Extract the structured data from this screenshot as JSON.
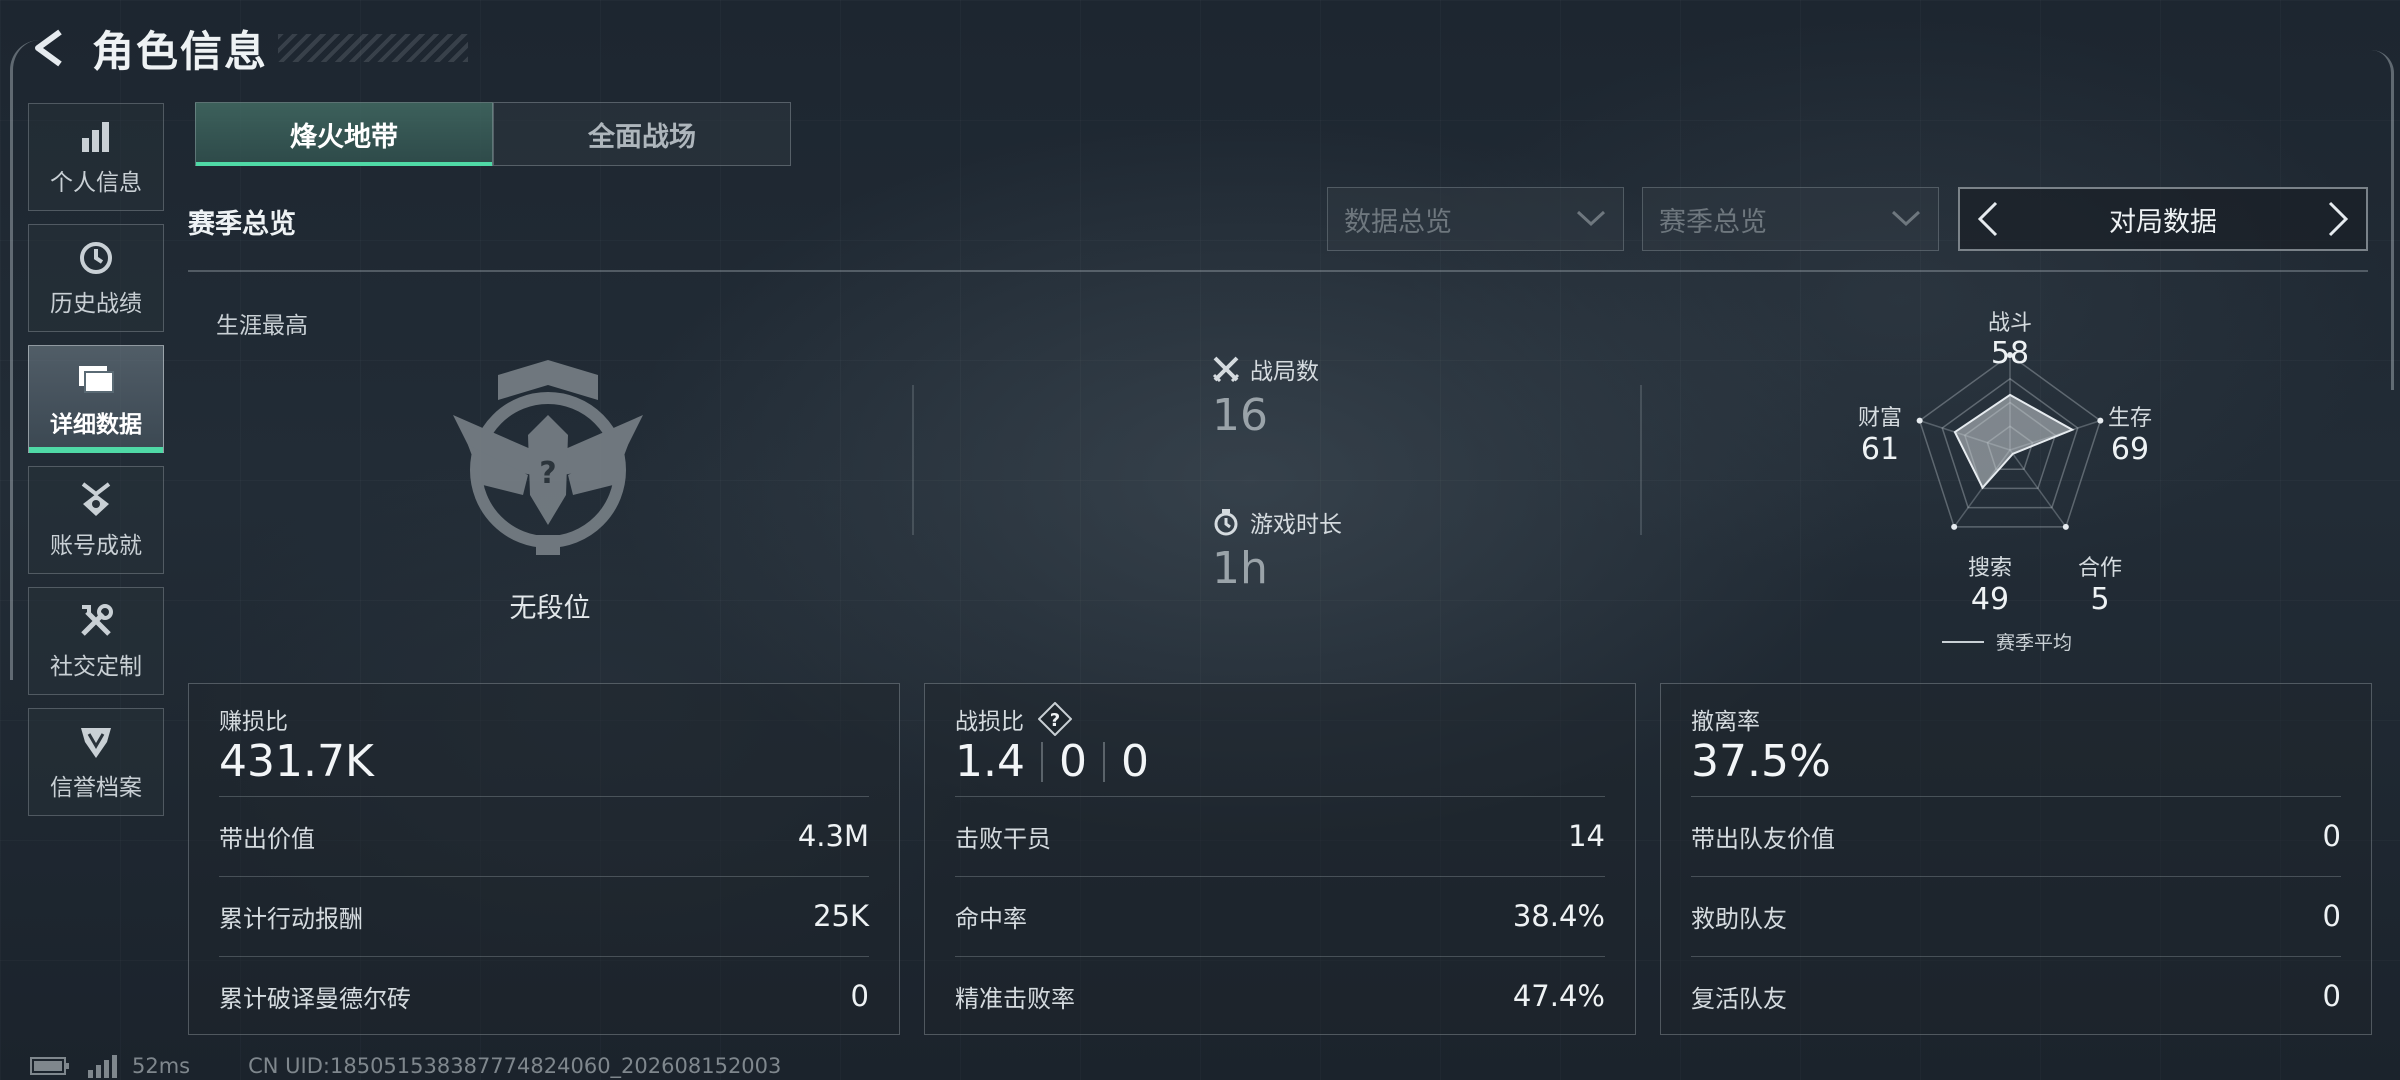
{
  "header": {
    "title": "角色信息"
  },
  "sidebar": {
    "items": [
      {
        "label": "个人信息",
        "icon": "bar-chart-icon"
      },
      {
        "label": "历史战绩",
        "icon": "history-clock-icon"
      },
      {
        "label": "详细数据",
        "icon": "folder-icon",
        "active": true
      },
      {
        "label": "账号成就",
        "icon": "medal-icon"
      },
      {
        "label": "社交定制",
        "icon": "tools-icon"
      },
      {
        "label": "信誉档案",
        "icon": "shield-badge-icon"
      }
    ]
  },
  "mode_tabs": [
    {
      "label": "烽火地带",
      "active": true
    },
    {
      "label": "全面战场",
      "active": false
    }
  ],
  "section": {
    "title": "赛季总览",
    "dropdown_data": "数据总览",
    "dropdown_season": "赛季总览",
    "stepper_label": "对局数据"
  },
  "overview": {
    "career_label": "生涯最高",
    "rank_text": "无段位",
    "matches_label": "战局数",
    "matches_value": "16",
    "playtime_label": "游戏时长",
    "playtime_value": "1h"
  },
  "radar": {
    "axes": [
      {
        "label": "战斗",
        "value": 58
      },
      {
        "label": "生存",
        "value": 69
      },
      {
        "label": "合作",
        "value": 5
      },
      {
        "label": "搜索",
        "value": 49
      },
      {
        "label": "财富",
        "value": 61
      }
    ],
    "legend": "赛季平均"
  },
  "cards": [
    {
      "label": "赚损比",
      "value": "431.7K",
      "rows": [
        {
          "label": "带出价值",
          "value": "4.3M"
        },
        {
          "label": "累计行动报酬",
          "value": "25K"
        },
        {
          "label": "累计破译曼德尔砖",
          "value": "0"
        }
      ]
    },
    {
      "label": "战损比",
      "values": [
        "1.4",
        "0",
        "0"
      ],
      "help": "?",
      "rows": [
        {
          "label": "击败干员",
          "value": "14"
        },
        {
          "label": "命中率",
          "value": "38.4%"
        },
        {
          "label": "精准击败率",
          "value": "47.4%"
        }
      ]
    },
    {
      "label": "撤离率",
      "value": "37.5%",
      "rows": [
        {
          "label": "带出队友价值",
          "value": "0"
        },
        {
          "label": "救助队友",
          "value": "0"
        },
        {
          "label": "复活队友",
          "value": "0"
        }
      ]
    }
  ],
  "footer": {
    "ping": "52ms",
    "uid": "CN UID:185051538387774824060_202608152003"
  },
  "colors": {
    "accent": "#4fd9a6",
    "background": "#1f2831",
    "text": "#e6ebef"
  }
}
